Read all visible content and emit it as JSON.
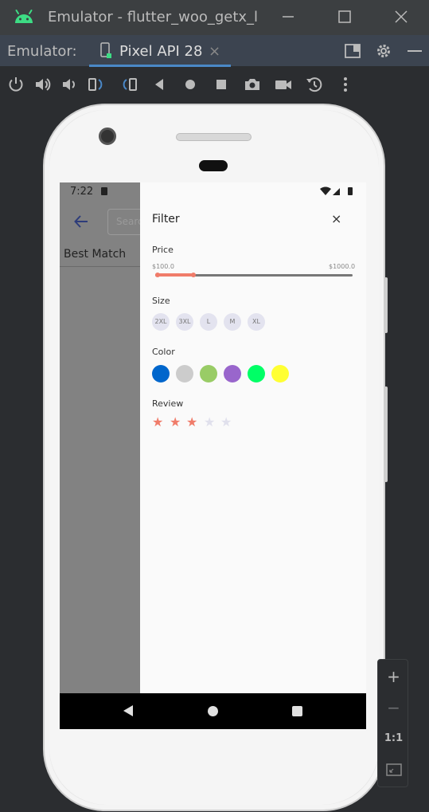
{
  "window": {
    "title": "Emulator - flutter_woo_getx_le"
  },
  "tabbar": {
    "label": "Emulator:",
    "tab_name": "Pixel API 28",
    "tab_close": "×"
  },
  "toolbar": {
    "icons": [
      "power-icon",
      "volume-up-icon",
      "volume-down-icon",
      "rotate-left-icon",
      "rotate-right-icon",
      "back-icon",
      "home-icon",
      "overview-icon",
      "screenshot-icon",
      "record-icon",
      "snapshot-icon",
      "more-icon"
    ]
  },
  "phone": {
    "status_time": "7:22",
    "underlay": {
      "search_placeholder": "Search",
      "best_match": "Best Match"
    },
    "filter": {
      "title": "Filter",
      "close": "×",
      "price_label": "Price",
      "price_min": "$100.0",
      "price_max": "$1000.0",
      "price_range_fraction": [
        0.0,
        0.19
      ],
      "size_label": "Size",
      "sizes": [
        "2XL",
        "3XL",
        "L",
        "M",
        "XL"
      ],
      "color_label": "Color",
      "colors": [
        "#0066cc",
        "#cccccc",
        "#99cc66",
        "#9966cc",
        "#00ff66",
        "#ffff33"
      ],
      "review_label": "Review",
      "rating": 3,
      "rating_max": 5,
      "star_active": "#f07c6a",
      "star_inactive": "#e0e0ec"
    }
  },
  "zoom": {
    "plus": "+",
    "minus": "−",
    "one_to_one": "1:1"
  }
}
